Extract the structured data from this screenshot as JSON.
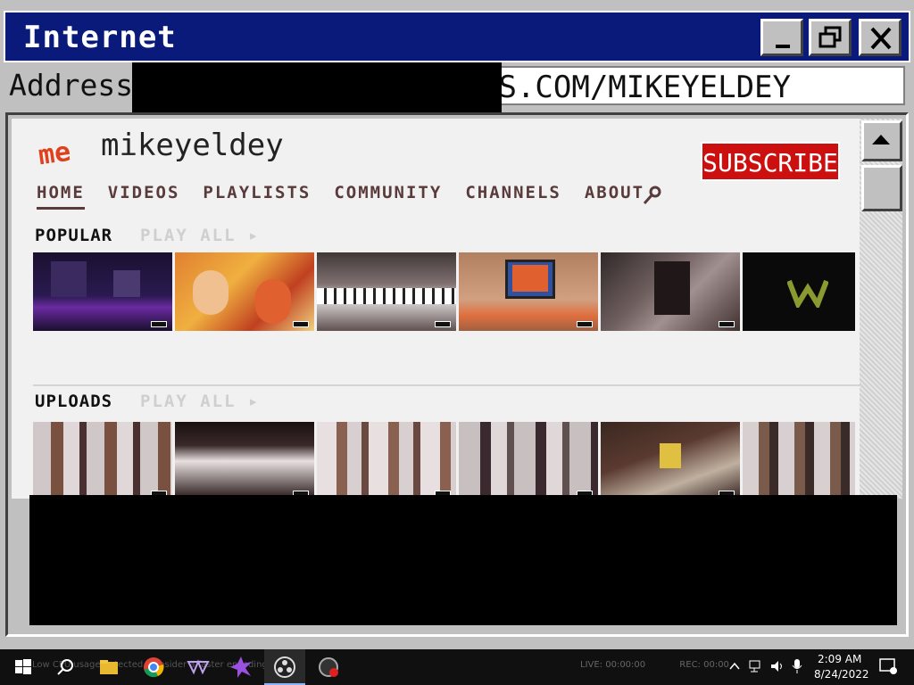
{
  "window": {
    "title": "Internet",
    "buttons": {
      "minimize": "minimize",
      "maximize": "maximize",
      "close": "close"
    }
  },
  "address": {
    "label": "Address",
    "url_visible": "ES.COM/MIKEYELDEY"
  },
  "channel": {
    "logo_text": "me",
    "name": "mikeyeldey",
    "subscribe_label": "SUBSCRIBE"
  },
  "nav": {
    "tabs": [
      "HOME",
      "VIDEOS",
      "PLAYLISTS",
      "COMMUNITY",
      "CHANNELS",
      "ABOUT"
    ],
    "active": "HOME"
  },
  "shelves": {
    "popular": {
      "title": "POPULAR",
      "play_all": "PLAY ALL",
      "videos": [
        {
          "title": "",
          "meta": ""
        },
        {
          "title": "",
          "meta": ""
        },
        {
          "title": "",
          "meta": ""
        },
        {
          "title": "",
          "meta": ""
        },
        {
          "title": "",
          "meta": ""
        },
        {
          "title": "",
          "meta": ""
        }
      ]
    },
    "uploads": {
      "title": "UPLOADS",
      "play_all": "PLAY ALL"
    }
  },
  "taskbar": {
    "live_text": "LIVE: 00:00:00",
    "rec_text": "REC: 00:00",
    "time": "2:09 AM",
    "date": "8/24/2022",
    "faded_text": "Low CPU usage detected, consider a faster encoding preset."
  },
  "colors": {
    "titlebar": "#0a1a7a",
    "subscribe": "#cc1010",
    "nav_text": "#5a3b3b",
    "logo": "#e0401e"
  }
}
